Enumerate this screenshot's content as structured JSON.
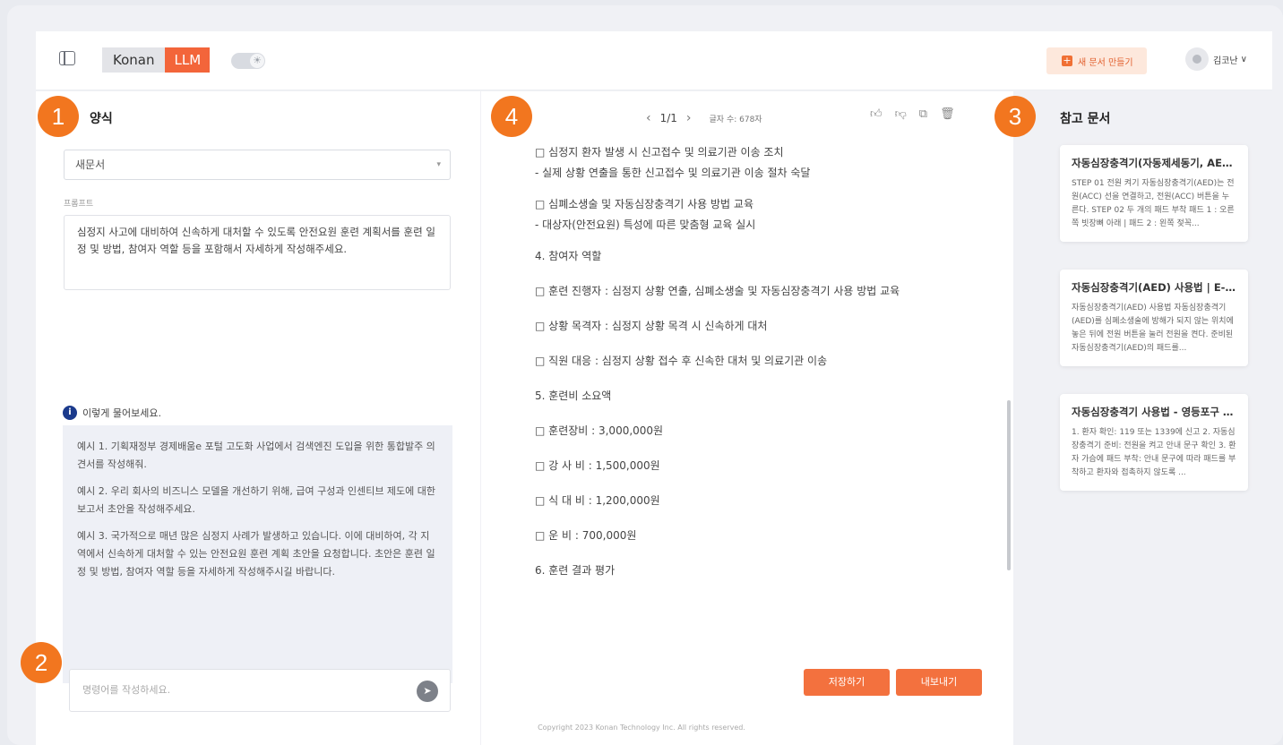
{
  "header": {
    "logo_name": "Konan",
    "logo_llm": "LLM",
    "theme_icon": "☀",
    "new_doc_label": "새 문서 만들기",
    "user_name": "김코난",
    "user_caret": "∨"
  },
  "left": {
    "title": "양식",
    "select_value": "새문서",
    "prompt_label": "프롬프트",
    "prompt_text": "심정지 사고에 대비하여 신속하게 대처할 수 있도록 안전요원 훈련 계획서를 훈련 일정 및 방법, 참여자 역할 등을 포함해서 자세하게 작성해주세요.",
    "info_text": "이렇게 물어보세요.",
    "examples": [
      "예시 1. 기획재정부 경제배움e 포털 고도화 사업에서 검색엔진 도입을 위한 통합발주 의견서를 작성해줘.",
      "예시 2. 우리 회사의 비즈니스 모델을 개선하기 위해, 급여 구성과 인센티브 제도에 대한 보고서 초안을 작성해주세요.",
      "예시 3. 국가적으로 매년 많은 심정지 사례가 발생하고 있습니다. 이에 대비하여, 각 지역에서 신속하게 대처할 수 있는 안전요원 훈련 계획 초안을 요청합니다. 초안은 훈련 일정 및 방법, 참여자 역할 등을 자세하게 작성해주시길 바랍니다."
    ],
    "command_placeholder": "명령어를 작성하세요."
  },
  "center": {
    "pager": "1/1",
    "char_count": "글자 수: 678자",
    "lines": [
      "□ 심정지 환자 발생 시 신고접수 및 의료기관 이송 조치",
      "- 실제 상황 연출을 통한 신고접수 및 의료기관 이송 절차 숙달",
      "□ 심폐소생술 및 자동심장충격기 사용 방법 교육",
      "- 대상자(안전요원) 특성에 따른 맞춤형 교육 실시",
      "4. 참여자 역할",
      "□ 훈련 진행자 : 심정지 상황 연출, 심폐소생술 및 자동심장충격기 사용 방법 교육",
      "□ 상황 목격자 : 심정지 상황 목격 시 신속하게 대처",
      "□ 직원 대응 : 심정지 상황 접수 후 신속한 대처 및 의료기관 이송",
      "5. 훈련비 소요액",
      "□ 훈련장비 : 3,000,000원",
      "□ 강 사 비 : 1,500,000원",
      "□ 식 대 비 : 1,200,000원",
      "□ 운 비 : 700,000원",
      "6. 훈련 결과 평가"
    ],
    "save_label": "저장하기",
    "export_label": "내보내기"
  },
  "right": {
    "title": "참고 문서",
    "refs": [
      {
        "title": "자동심장충격기(자동제세동기, AED)...",
        "desc": "STEP 01 전원 켜기 자동심장충격기(AED)는 전원(ACC) 선을 연결하고, 전원(ACC) 버튼을 누른다. STEP 02 두 개의 패드 부착 패드 1 : 오른쪽 빗장뼈 아래 | 패드 2 : 왼쪽 젖꼭..."
      },
      {
        "title": "자동심장충격기(AED) 사용법 | E-G...",
        "desc": "자동심장충격기(AED) 사용법 자동심장충격기(AED)를 심폐소생술에 방해가 되지 않는 위치에 놓은 뒤에 전원 버튼을 눌러 전원을 켠다. 준비된 자동심장충격기(AED)의 패드를..."
      },
      {
        "title": "자동심장충격기 사용법 - 영등포구 보...",
        "desc": "1. 환자 확인: 119 또는 1339에 신고 2. 자동심장충격기 준비: 전원을 켜고 안내 문구 확인 3. 환자 가슴에 패드 부착: 안내 문구에 따라 패드를 부착하고 환자와 접촉하지 않도록 ..."
      }
    ]
  },
  "footer": "Copyright 2023 Konan Technology Inc. All rights reserved.",
  "callouts": [
    "1",
    "2",
    "3",
    "4"
  ],
  "colors": {
    "accent": "#f3713e",
    "callout": "#f2761f",
    "info": "#1b3a8c"
  }
}
